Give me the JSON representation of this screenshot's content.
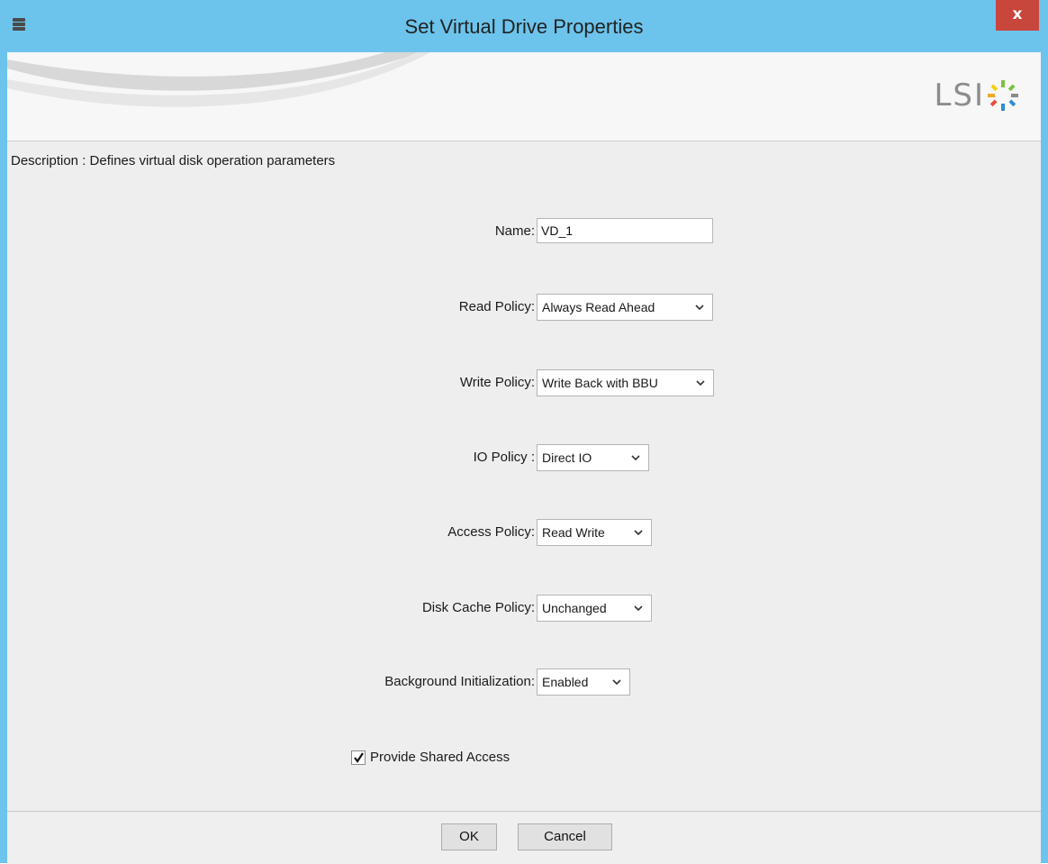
{
  "window": {
    "title": "Set Virtual Drive Properties",
    "close_label": "x",
    "titlebar_color": "#6cc4ec",
    "close_color": "#c9463d",
    "app_icon": "database-icon"
  },
  "banner": {
    "logo_text": "LSI",
    "logo_icon": "lsi-starburst-icon"
  },
  "description": "Description : Defines virtual disk operation parameters",
  "form": {
    "name": {
      "label": "Name:",
      "value": "VD_1"
    },
    "read_policy": {
      "label": "Read Policy:",
      "value": "Always Read Ahead"
    },
    "write_policy": {
      "label": "Write Policy:",
      "value": "Write Back with BBU"
    },
    "io_policy": {
      "label": "IO Policy :",
      "value": "Direct IO"
    },
    "access_policy": {
      "label": "Access Policy:",
      "value": "Read Write"
    },
    "disk_cache_policy": {
      "label": "Disk Cache Policy:",
      "value": "Unchanged"
    },
    "background_init": {
      "label": "Background Initialization:",
      "value": "Enabled"
    },
    "shared_access": {
      "label": "Provide Shared Access",
      "checked": true
    }
  },
  "buttons": {
    "ok": "OK",
    "cancel": "Cancel"
  }
}
